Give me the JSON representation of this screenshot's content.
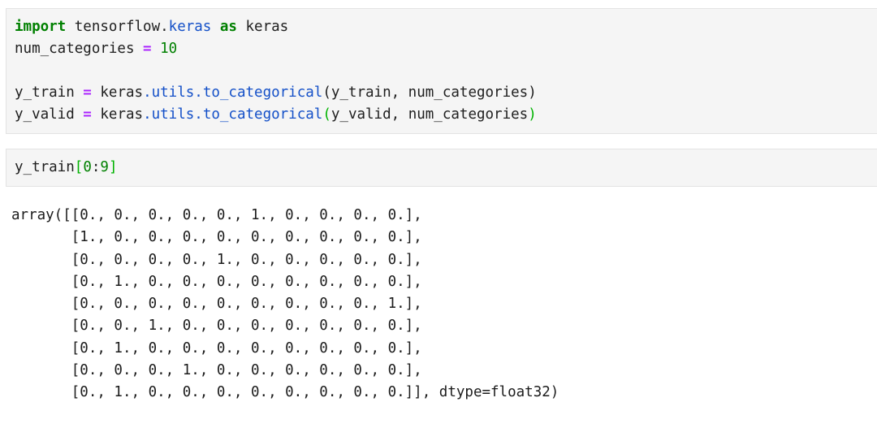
{
  "notebook": {
    "cells": [
      {
        "name": "code-cell-import",
        "type": "code",
        "lines": [
          {
            "tokens": [
              {
                "text": "import",
                "kind": "keyword"
              },
              {
                "text": " tensorflow.",
                "kind": "plain"
              },
              {
                "text": "keras",
                "kind": "module"
              },
              {
                "text": " ",
                "kind": "plain"
              },
              {
                "text": "as",
                "kind": "keyword"
              },
              {
                "text": " keras",
                "kind": "plain"
              }
            ]
          },
          {
            "tokens": [
              {
                "text": "num_categories ",
                "kind": "plain"
              },
              {
                "text": "=",
                "kind": "operator"
              },
              {
                "text": " ",
                "kind": "plain"
              },
              {
                "text": "10",
                "kind": "number"
              }
            ]
          },
          {
            "tokens": []
          },
          {
            "tokens": [
              {
                "text": "y_train ",
                "kind": "plain"
              },
              {
                "text": "=",
                "kind": "operator"
              },
              {
                "text": " keras",
                "kind": "plain"
              },
              {
                "text": ".utils.to_categorical",
                "kind": "function"
              },
              {
                "text": "(y_train, num_categories)",
                "kind": "plain"
              }
            ]
          },
          {
            "tokens": [
              {
                "text": "y_valid ",
                "kind": "plain"
              },
              {
                "text": "=",
                "kind": "operator"
              },
              {
                "text": " keras",
                "kind": "plain"
              },
              {
                "text": ".utils.to_categorical",
                "kind": "function"
              },
              {
                "text": "(",
                "kind": "greenparen"
              },
              {
                "text": "y_valid, num_categories",
                "kind": "plain"
              },
              {
                "text": ")",
                "kind": "greenparen"
              }
            ]
          }
        ]
      },
      {
        "name": "code-cell-slice",
        "type": "code",
        "lines": [
          {
            "tokens": [
              {
                "text": "y_train",
                "kind": "plain"
              },
              {
                "text": "[",
                "kind": "bracket"
              },
              {
                "text": "0",
                "kind": "number"
              },
              {
                "text": ":",
                "kind": "plain"
              },
              {
                "text": "9",
                "kind": "number"
              },
              {
                "text": "]",
                "kind": "bracket"
              }
            ]
          }
        ]
      }
    ],
    "output": {
      "name": "array-output",
      "lines": [
        "array([[0., 0., 0., 0., 0., 1., 0., 0., 0., 0.],",
        "       [1., 0., 0., 0., 0., 0., 0., 0., 0., 0.],",
        "       [0., 0., 0., 0., 1., 0., 0., 0., 0., 0.],",
        "       [0., 1., 0., 0., 0., 0., 0., 0., 0., 0.],",
        "       [0., 0., 0., 0., 0., 0., 0., 0., 0., 1.],",
        "       [0., 0., 1., 0., 0., 0., 0., 0., 0., 0.],",
        "       [0., 1., 0., 0., 0., 0., 0., 0., 0., 0.],",
        "       [0., 0., 0., 1., 0., 0., 0., 0., 0., 0.],",
        "       [0., 1., 0., 0., 0., 0., 0., 0., 0., 0.]], dtype=float32)"
      ]
    }
  },
  "colors": {
    "cell_background": "#f5f5f5",
    "cell_border": "#e3e3e3",
    "page_background": "#ffffff",
    "keyword": "#008000",
    "module": "#1450c8",
    "function": "#1450c8",
    "operator": "#aa22ff",
    "number": "#008000",
    "bracket": "#00b300",
    "text": "#202020"
  }
}
